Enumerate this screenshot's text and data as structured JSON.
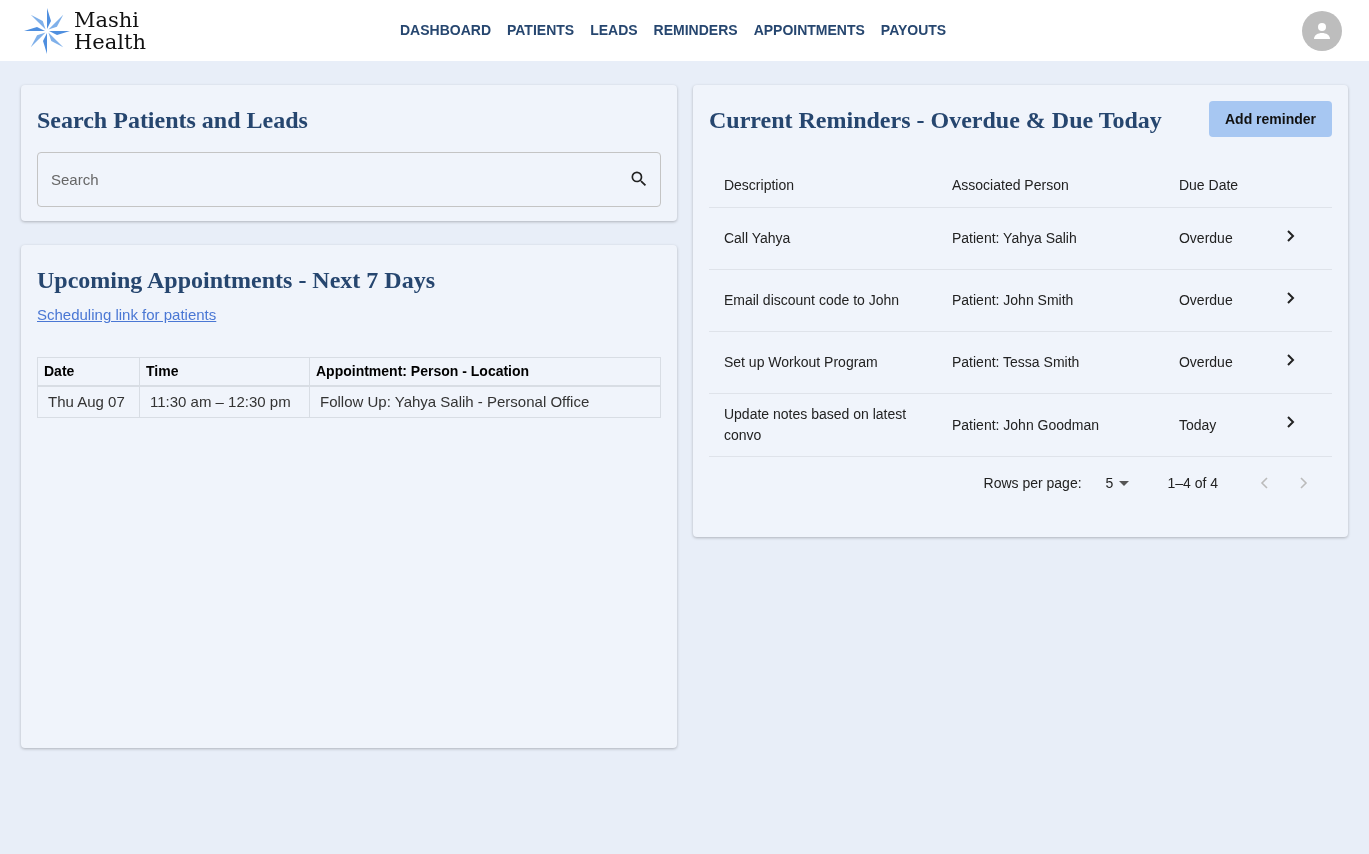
{
  "header": {
    "logo_text": [
      "Mashi",
      "Health"
    ],
    "nav": [
      {
        "label": "DASHBOARD",
        "selected": false
      },
      {
        "label": "PATIENTS",
        "selected": false
      },
      {
        "label": "LEADS",
        "selected": false
      },
      {
        "label": "REMINDERS",
        "selected": false
      },
      {
        "label": "APPOINTMENTS",
        "selected": false
      },
      {
        "label": "PAYOUTS",
        "selected": false
      }
    ]
  },
  "search_card": {
    "title": "Search Patients and Leads",
    "search": {
      "placeholder": "Search"
    }
  },
  "appointments_card": {
    "title": "Upcoming Appointments - Next 7 Days",
    "link": "Scheduling link for patients",
    "table": {
      "columns": [
        "Date",
        "Time",
        "Appointment: Person - Location"
      ],
      "rows": [
        [
          "Thu Aug 07",
          "11:30 am – 12:30 pm",
          "Follow Up: Yahya Salih - Personal Office"
        ]
      ]
    }
  },
  "reminders_card": {
    "title": "Current Reminders - Overdue & Due Today",
    "add_button": "Add reminder",
    "table": {
      "columns": [
        "Description",
        "Associated Person",
        "Due Date"
      ],
      "rows": [
        [
          "Call Yahya",
          "Patient: Yahya Salih",
          "Overdue"
        ],
        [
          "Email discount code to John",
          "Patient: John Smith",
          "Overdue"
        ],
        [
          "Set up Workout Program",
          "Patient: Tessa Smith",
          "Overdue"
        ],
        [
          "Update notes based on latest convo",
          "Patient: John Goodman",
          "Today"
        ]
      ]
    },
    "pagination": {
      "rows_label": "Rows per page:",
      "rows_value": "5",
      "range": "1–4 of 4",
      "prev_disabled": true,
      "next_disabled": true
    }
  }
}
